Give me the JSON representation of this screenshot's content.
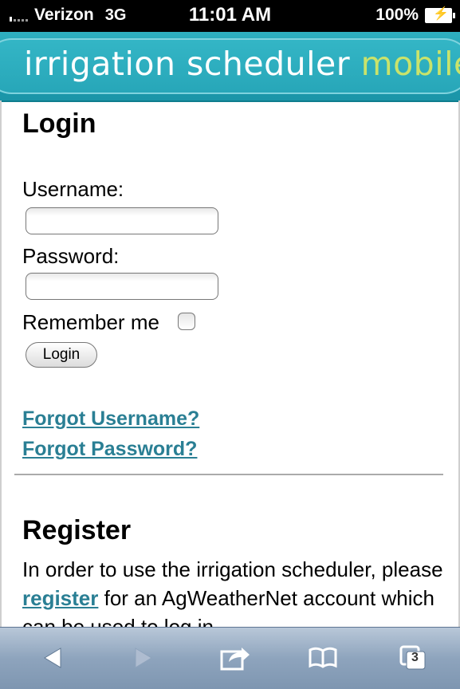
{
  "status_bar": {
    "carrier": "Verizon",
    "network": "3G",
    "time": "11:01 AM",
    "battery": "100%"
  },
  "banner": {
    "title_main": "irrigation scheduler",
    "title_accent": "mobile"
  },
  "login": {
    "title": "Login",
    "username_label": "Username:",
    "username_value": "",
    "password_label": "Password:",
    "password_value": "",
    "remember_label": "Remember me",
    "remember_checked": false,
    "login_button": "Login",
    "forgot_username": "Forgot Username?",
    "forgot_password": "Forgot Password?"
  },
  "register": {
    "title": "Register",
    "text_before": "In order to use the irrigation scheduler, please ",
    "link": "register",
    "text_after": " for an AgWeatherNet account which can be used to log in."
  },
  "toolbar": {
    "back_icon": "back-arrow-icon",
    "forward_icon": "forward-arrow-icon",
    "share_icon": "share-icon",
    "bookmarks_icon": "bookmarks-icon",
    "tabs_icon": "tabs-icon",
    "tabs_count": "3"
  },
  "colors": {
    "banner": "#1c9aae",
    "link": "#2a7f94",
    "accent": "#c9e36b"
  }
}
